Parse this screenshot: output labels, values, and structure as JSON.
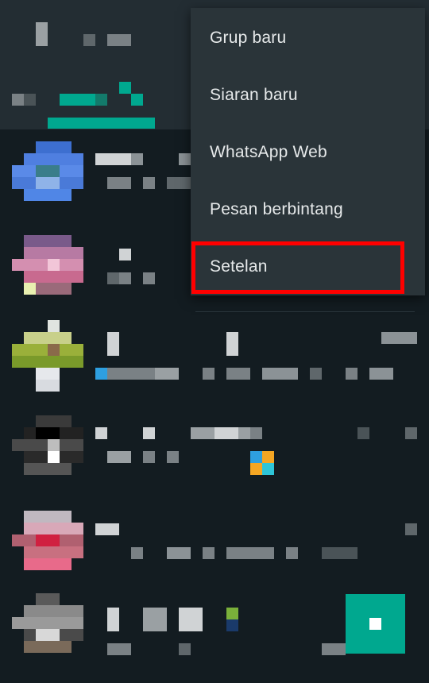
{
  "menu": {
    "items": [
      {
        "label": "Grup baru"
      },
      {
        "label": "Siaran baru"
      },
      {
        "label": "WhatsApp Web"
      },
      {
        "label": "Pesan berbintang"
      },
      {
        "label": "Setelan"
      }
    ]
  },
  "colors": {
    "background": "#131c21",
    "header": "#232d33",
    "accent": "#00a88f",
    "menu_background": "#2a3439",
    "highlight": "#ff0000"
  },
  "icons": {
    "fab": "new-chat-icon"
  }
}
